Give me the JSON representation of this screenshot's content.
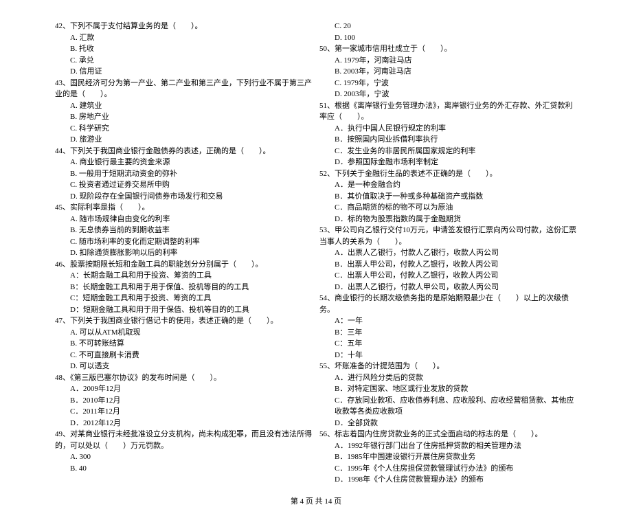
{
  "left": {
    "q42": {
      "text": "42、下列不属于支付结算业务的是（　　）。",
      "a": "A. 汇款",
      "b": "B. 托收",
      "c": "C. 承兑",
      "d": "D. 信用证"
    },
    "q43": {
      "text": "43、国民经济可分为第一产业、第二产业和第三产业，下列行业不属于第三产业的是（　　）。",
      "a": "A. 建筑业",
      "b": "B. 房地产业",
      "c": "C. 科学研究",
      "d": "D. 旅游业"
    },
    "q44": {
      "text": "44、下列关于我国商业银行金融债券的表述，正确的是（　　）。",
      "a": "A. 商业银行最主要的资金来源",
      "b": "B. 一般用于短期流动资金的弥补",
      "c": "C. 投资者通过证券交易所申购",
      "d": "D. 现阶段存在全国银行间债券市场发行和交易"
    },
    "q45": {
      "text": "45、实际利率是指（　　）。",
      "a": "A. 随市场规律自由变化的利率",
      "b": "B. 无息债券当前的到期收益率",
      "c": "C. 随市场利率的变化而定期调整的利率",
      "d": "D. 扣除通货膨胀影响以后的利率"
    },
    "q46": {
      "text": "46、股票按期限长短和金融工具的职能划分分别属于（　　）。",
      "a": "A：长期金融工具和用于投资、筹资的工具",
      "b": "B：长期金融工具和用于用于保值、投机等目的的工具",
      "c": "C：短期金融工具和用于投资、筹资的工具",
      "d": "D：短期金融工具和用于用于保值、投机等目的的工具"
    },
    "q47": {
      "text": "47、下列关于我国商业银行借记卡的使用，表述正确的是（　　）。",
      "a": "A. 可以从ATM机取现",
      "b": "B. 不可转账结算",
      "c": "C. 不可直接刷卡消费",
      "d": "D. 可以透支"
    },
    "q48": {
      "text": "48、《第三版巴塞尔协议》的发布时间是（　　）。",
      "a": "A．2009年12月",
      "b": "B．2010年12月",
      "c": "C．2011年12月",
      "d": "D．2012年12月"
    },
    "q49": {
      "text": "49、对某商业银行未经批准设立分支机构，尚未构成犯罪，而且没有违法所得的，可以处以（　　）万元罚款。",
      "a": "A. 300",
      "b": "B. 40"
    }
  },
  "right": {
    "q49cd": {
      "c": "C. 20",
      "d": "D. 100"
    },
    "q50": {
      "text": "50、第一家城市信用社成立于（　　）。",
      "a": "A. 1979年，河南驻马店",
      "b": "B. 2003年，河南驻马店",
      "c": "C. 1979年，宁波",
      "d": "D. 2003年，宁波"
    },
    "q51": {
      "text": "51、根据《离岸银行业务管理办法》，离岸银行业务的外汇存款、外汇贷款利率应（　　）。",
      "a": "A．执行中国人民银行规定的利率",
      "b": "B．按照国内同业拆借利率执行",
      "c": "C．发生业务的非居民所属国家规定的利率",
      "d": "D．参照国际金融市场利率制定"
    },
    "q52": {
      "text": "52、下列关于金融衍生品的表述不正确的是（　　）。",
      "a": "A．是一种金融合约",
      "b": "B．其价值取决于一种或多种基础资产或指数",
      "c": "C．商品期货的标的物不可以为原油",
      "d": "D．标的物为股票指数的属于金融期货"
    },
    "q53": {
      "text": "53、甲公司向乙银行交付10万元，申请签发银行汇票向丙公司付款，这份汇票当事人的关系为（　　）。",
      "a": "A．出票人乙银行，付款人乙银行，收款人丙公司",
      "b": "B．出票人甲公司，付款人乙银行，收款人丙公司",
      "c": "C．出票人甲公司，付款人乙银行，收款人丙公司",
      "d": "D．出票人乙银行，付款人甲公司，收款人丙公司"
    },
    "q54": {
      "text": "54、商业银行的长期次级债务指的是原始期限最少在（　　）以上的次级债务。",
      "a": "A：一年",
      "b": "B：三年",
      "c": "C：五年",
      "d": "D：十年"
    },
    "q55": {
      "text": "55、坏账准备的计提范围为（　　）。",
      "a": "A．进行风险分类后的贷款",
      "b": "B．对特定国家、地区或行业发放的贷款",
      "c": "C．存放同业款项、应收债券利息、应收股利、应收经营租赁款、其他应收款等各类应收款项",
      "d": "D．全部贷款"
    },
    "q56": {
      "text": "56、标志着国内住房贷款业务的正式全面启动的标志的是（　　）。",
      "a": "A．1992年银行部门出台了住房抵押贷款的相关管理办法",
      "b": "B．1985年中国建设银行开展住房贷款业务",
      "c": "C．1995年《个人住房担保贷款管理试行办法》的颁布",
      "d": "D．1998年《个人住房贷款管理办法》的颁布"
    }
  },
  "footer": "第 4 页 共 14 页"
}
